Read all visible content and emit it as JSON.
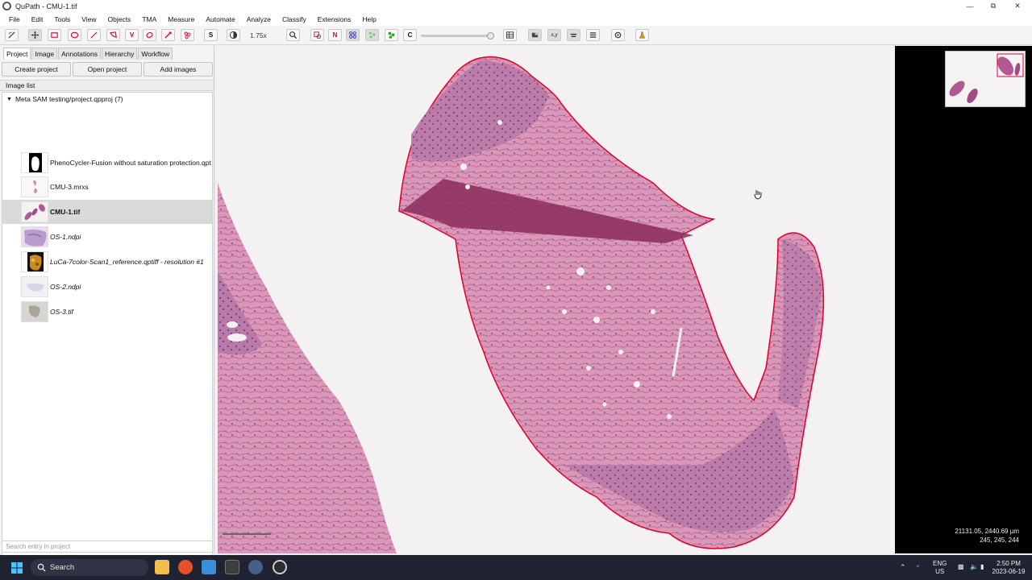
{
  "window": {
    "title": "QuPath - CMU-1.tif",
    "minimize": "—",
    "maximize": "⧉",
    "close": "✕"
  },
  "menus": [
    "File",
    "Edit",
    "Tools",
    "View",
    "Objects",
    "TMA",
    "Measure",
    "Automate",
    "Analyze",
    "Classify",
    "Extensions",
    "Help"
  ],
  "toolbar": {
    "zoom": "1.75x",
    "letters": {
      "s": "S",
      "n": "N",
      "c": "C",
      "v": "V"
    }
  },
  "left_panel": {
    "tabs": [
      "Project",
      "Image",
      "Annotations",
      "Hierarchy",
      "Workflow"
    ],
    "active_tab": "Project",
    "buttons": {
      "create": "Create project",
      "open": "Open project",
      "add": "Add images"
    },
    "list_title": "Image list",
    "project_name": "Meta SAM testing/project.qpproj (7)",
    "images": [
      {
        "label": "PhenoCycler-Fusion without saturation protection.qptiff -",
        "style": "normal",
        "thumb": "fluorescence-mask"
      },
      {
        "label": "CMU-3.mrxs",
        "style": "normal",
        "thumb": "he-small"
      },
      {
        "label": "CMU-1.tif",
        "style": "bold",
        "thumb": "he-slide"
      },
      {
        "label": "OS-1.ndpi",
        "style": "italic",
        "thumb": "he-purple"
      },
      {
        "label": "LuCa-7color-Scan1_reference.qptiff - resolution #1",
        "style": "italic",
        "thumb": "fluorescence-color"
      },
      {
        "label": "OS-2.ndpi",
        "style": "italic",
        "thumb": "pale"
      },
      {
        "label": "OS-3.tif",
        "style": "italic",
        "thumb": "grey"
      }
    ],
    "search_placeholder": "Search entry in project"
  },
  "viewer": {
    "coords": "21131.05, 2440.69 µm",
    "pixel_value": "245, 245, 244"
  },
  "taskbar": {
    "search": "Search",
    "lang": "ENG",
    "region": "US",
    "time": "2:50 PM",
    "date": "2023-06-19"
  },
  "colors": {
    "tissue_light": "#d88fb0",
    "tissue_dark": "#6a3a78",
    "annotation": "#e0002b",
    "background": "#f3f1f1"
  }
}
